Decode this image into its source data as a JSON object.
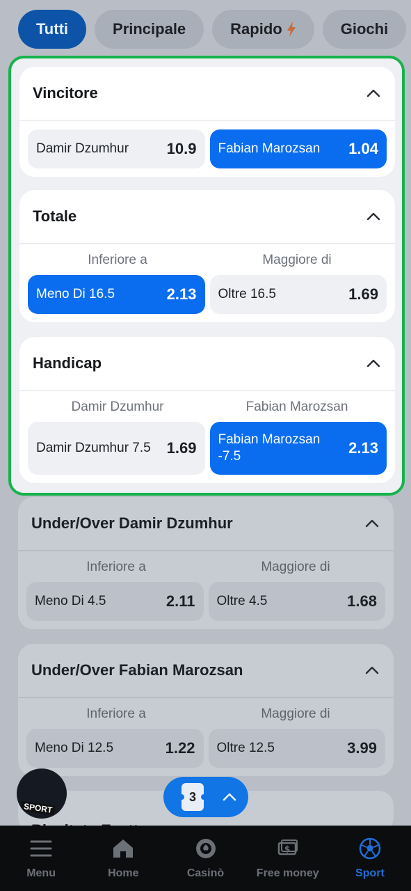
{
  "tabs": [
    {
      "label": "Tutti",
      "active": true
    },
    {
      "label": "Principale",
      "active": false
    },
    {
      "label": "Rapido",
      "active": false
    },
    {
      "label": "Giochi",
      "active": false
    }
  ],
  "markets": {
    "vincitore": {
      "title": "Vincitore",
      "options": [
        {
          "label": "Damir Dzumhur",
          "odd": "10.9",
          "selected": false
        },
        {
          "label": "Fabian Marozsan",
          "odd": "1.04",
          "selected": true
        }
      ]
    },
    "totale": {
      "title": "Totale",
      "col_left": "Inferiore a",
      "col_right": "Maggiore di",
      "options": [
        {
          "label": "Meno Di 16.5",
          "odd": "2.13",
          "selected": true
        },
        {
          "label": "Oltre 16.5",
          "odd": "1.69",
          "selected": false
        }
      ]
    },
    "handicap": {
      "title": "Handicap",
      "col_left": "Damir Dzumhur",
      "col_right": "Fabian Marozsan",
      "options": [
        {
          "label": "Damir Dzumhur 7.5",
          "odd": "1.69",
          "selected": false
        },
        {
          "label_line1": "Fabian Marozsan",
          "label_line2": "-7.5",
          "odd": "2.13",
          "selected": true
        }
      ]
    },
    "uo_dzumhur": {
      "title": "Under/Over Damir Dzumhur",
      "col_left": "Inferiore a",
      "col_right": "Maggiore di",
      "options": [
        {
          "label": "Meno Di 4.5",
          "odd": "2.11"
        },
        {
          "label": "Oltre 4.5",
          "odd": "1.68"
        }
      ]
    },
    "uo_marozsan": {
      "title": "Under/Over Fabian Marozsan",
      "col_left": "Inferiore a",
      "col_right": "Maggiore di",
      "options": [
        {
          "label": "Meno Di 12.5",
          "odd": "1.22"
        },
        {
          "label": "Oltre 12.5",
          "odd": "3.99"
        }
      ]
    },
    "risultato": {
      "title": "Risultato Esatto"
    }
  },
  "fab": {
    "label": "SPORT"
  },
  "betslip": {
    "count": "3"
  },
  "nav": [
    {
      "label": "Menu",
      "icon": "menu-icon"
    },
    {
      "label": "Home",
      "icon": "home-icon"
    },
    {
      "label": "Casinò",
      "icon": "casino-chip-icon"
    },
    {
      "label": "Free money",
      "icon": "money-icon"
    },
    {
      "label": "Sport",
      "icon": "soccer-ball-icon",
      "active": true
    }
  ]
}
